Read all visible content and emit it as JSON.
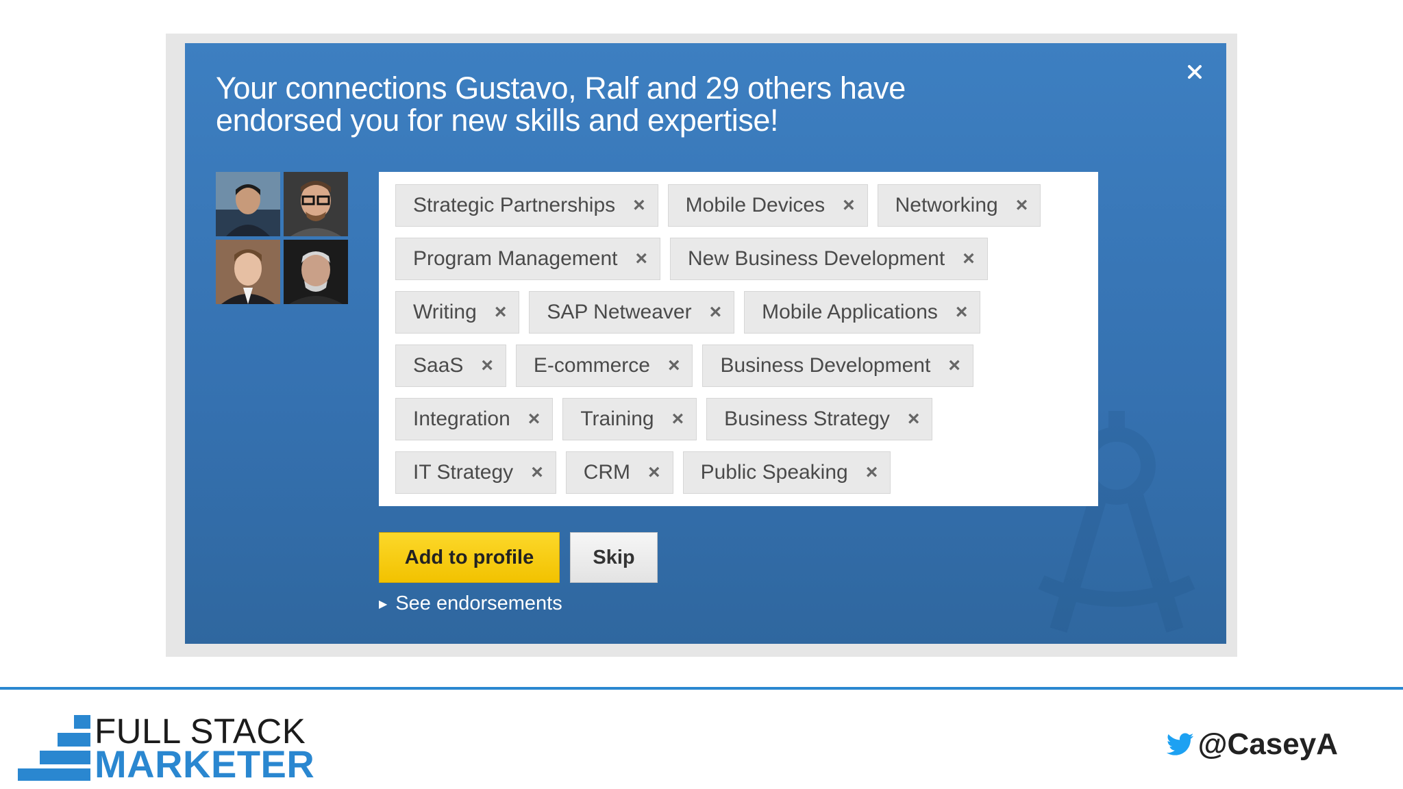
{
  "modal": {
    "headline_line1": "Your connections Gustavo, Ralf and 29 others have",
    "headline_line2": "endorsed you for new skills and expertise!",
    "close_glyph": "×",
    "skill_rows": [
      [
        "Strategic Partnerships",
        "Mobile Devices",
        "Networking"
      ],
      [
        "Program Management",
        "New Business Development"
      ],
      [
        "Writing",
        "SAP Netweaver",
        "Mobile Applications"
      ],
      [
        "SaaS",
        "E-commerce",
        "Business Development"
      ],
      [
        "Integration",
        "Training",
        "Business Strategy"
      ],
      [
        "IT Strategy",
        "CRM",
        "Public Speaking"
      ]
    ],
    "remove_glyph": "×",
    "add_button": "Add to profile",
    "skip_button": "Skip",
    "see_endorsements": "See endorsements",
    "caret_glyph": "▶"
  },
  "footer": {
    "logo_line1": "FULL STACK",
    "logo_line2": "MARKETER",
    "twitter_handle": "@CaseyA"
  },
  "colors": {
    "modal_blue": "#3a7bbd",
    "accent_yellow": "#f7cf16",
    "brand_blue": "#2a87d0"
  },
  "icons": {
    "close": "close-icon",
    "remove": "remove-skill-icon",
    "twitter": "twitter-bird-icon",
    "watermark": "compass-icon"
  }
}
